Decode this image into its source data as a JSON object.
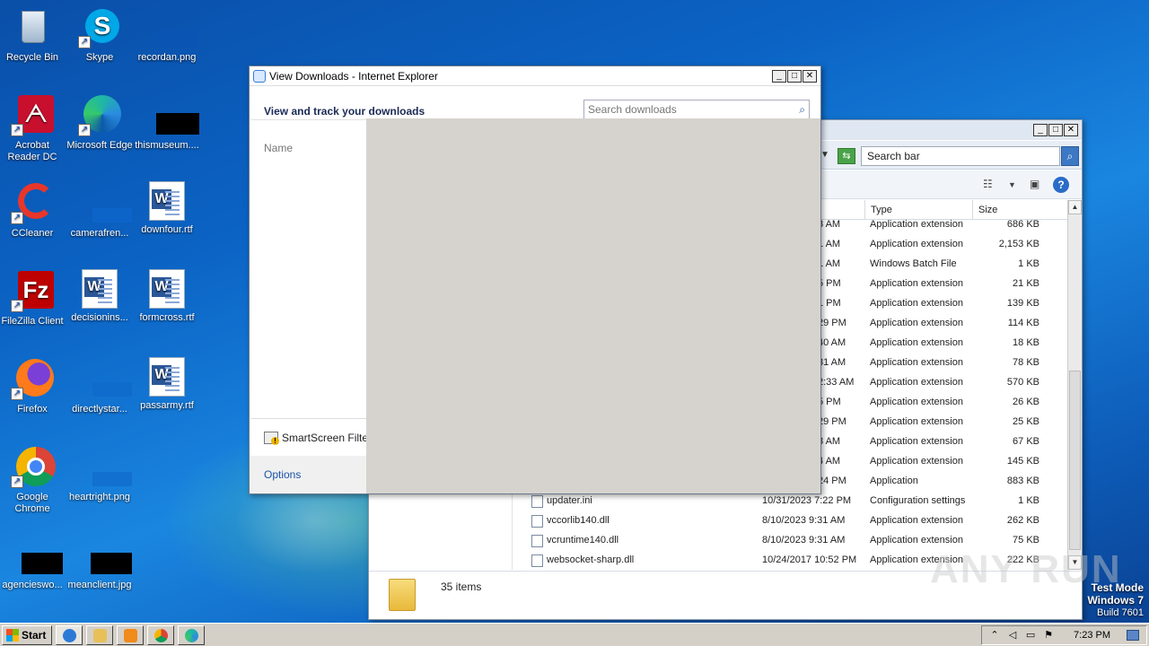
{
  "desktop": {
    "icons": [
      {
        "label": "Recycle Bin",
        "icon": "recycle-bin-icon"
      },
      {
        "label": "Skype",
        "icon": "skype-icon"
      },
      {
        "label": "recordan.png",
        "icon": "image-file-icon"
      },
      {
        "label": "Acrobat Reader DC",
        "icon": "acrobat-icon"
      },
      {
        "label": "Microsoft Edge",
        "icon": "edge-icon"
      },
      {
        "label": "thismuseum....",
        "icon": "image-file-icon"
      },
      {
        "label": "CCleaner",
        "icon": "ccleaner-icon"
      },
      {
        "label": "camerafren...",
        "icon": "image-file-icon"
      },
      {
        "label": "downfour.rtf",
        "icon": "word-document-icon"
      },
      {
        "label": "FileZilla Client",
        "icon": "filezilla-icon"
      },
      {
        "label": "decisionins...",
        "icon": "word-document-icon"
      },
      {
        "label": "formcross.rtf",
        "icon": "word-document-icon"
      },
      {
        "label": "Firefox",
        "icon": "firefox-icon"
      },
      {
        "label": "directlystar...",
        "icon": "image-file-icon"
      },
      {
        "label": "passarmy.rtf",
        "icon": "word-document-icon"
      },
      {
        "label": "Google Chrome",
        "icon": "chrome-icon"
      },
      {
        "label": "heartright.png",
        "icon": "image-file-icon"
      },
      {
        "label": "agencieswo...",
        "icon": "image-file-icon"
      },
      {
        "label": "meanclient.jpg",
        "icon": "image-file-icon"
      }
    ]
  },
  "ie_window": {
    "title": "View Downloads - Internet Explorer",
    "heading": "View and track your downloads",
    "search_placeholder": "Search downloads",
    "column_name": "Name",
    "smartscreen_label": "SmartScreen Filter",
    "options_link": "Options"
  },
  "explorer": {
    "search_value": "Search bar",
    "columns": {
      "type": "Type",
      "size": "Size"
    },
    "rows": [
      {
        "name": "",
        "date": "3 AM",
        "type": "Application extension",
        "size": "686 KB"
      },
      {
        "name": "",
        "date": "1 AM",
        "type": "Application extension",
        "size": "2,153 KB"
      },
      {
        "name": "",
        "date": "1 AM",
        "type": "Windows Batch File",
        "size": "1 KB"
      },
      {
        "name": "",
        "date": "5 PM",
        "type": "Application extension",
        "size": "21 KB"
      },
      {
        "name": "",
        "date": "1 PM",
        "type": "Application extension",
        "size": "139 KB"
      },
      {
        "name": "",
        "date": "29 PM",
        "type": "Application extension",
        "size": "114 KB"
      },
      {
        "name": "",
        "date": "40 AM",
        "type": "Application extension",
        "size": "18 KB"
      },
      {
        "name": "",
        "date": "31 AM",
        "type": "Application extension",
        "size": "78 KB"
      },
      {
        "name": "",
        "date": "2:33 AM",
        "type": "Application extension",
        "size": "570 KB"
      },
      {
        "name": "",
        "date": "5 PM",
        "type": "Application extension",
        "size": "26 KB"
      },
      {
        "name": "",
        "date": "29 PM",
        "type": "Application extension",
        "size": "25 KB"
      },
      {
        "name": "",
        "date": "3 AM",
        "type": "Application extension",
        "size": "67 KB"
      },
      {
        "name": "",
        "date": "4 AM",
        "type": "Application extension",
        "size": "145 KB"
      },
      {
        "name": "",
        "date": "24 PM",
        "type": "Application",
        "size": "883 KB"
      },
      {
        "name": "updater.ini",
        "date": "10/31/2023 7:22 PM",
        "type": "Configuration settings",
        "size": "1 KB"
      },
      {
        "name": "vccorlib140.dll",
        "date": "8/10/2023 9:31 AM",
        "type": "Application extension",
        "size": "262 KB"
      },
      {
        "name": "vcruntime140.dll",
        "date": "8/10/2023 9:31 AM",
        "type": "Application extension",
        "size": "75 KB"
      },
      {
        "name": "websocket-sharp.dll",
        "date": "10/24/2017 10:52 PM",
        "type": "Application extension",
        "size": "222 KB"
      }
    ],
    "status_items": "35 items"
  },
  "watermark": "ANY RUN",
  "test_mode": {
    "line1": "Test Mode",
    "line2": "Windows 7",
    "line3": "Build 7601"
  },
  "taskbar": {
    "start_label": "Start",
    "clock": "7:23 PM"
  },
  "colors": {
    "desktop": "#0b63c4",
    "ie_grey": "#d6d3ce",
    "taskbar": "#d4d0c8"
  }
}
